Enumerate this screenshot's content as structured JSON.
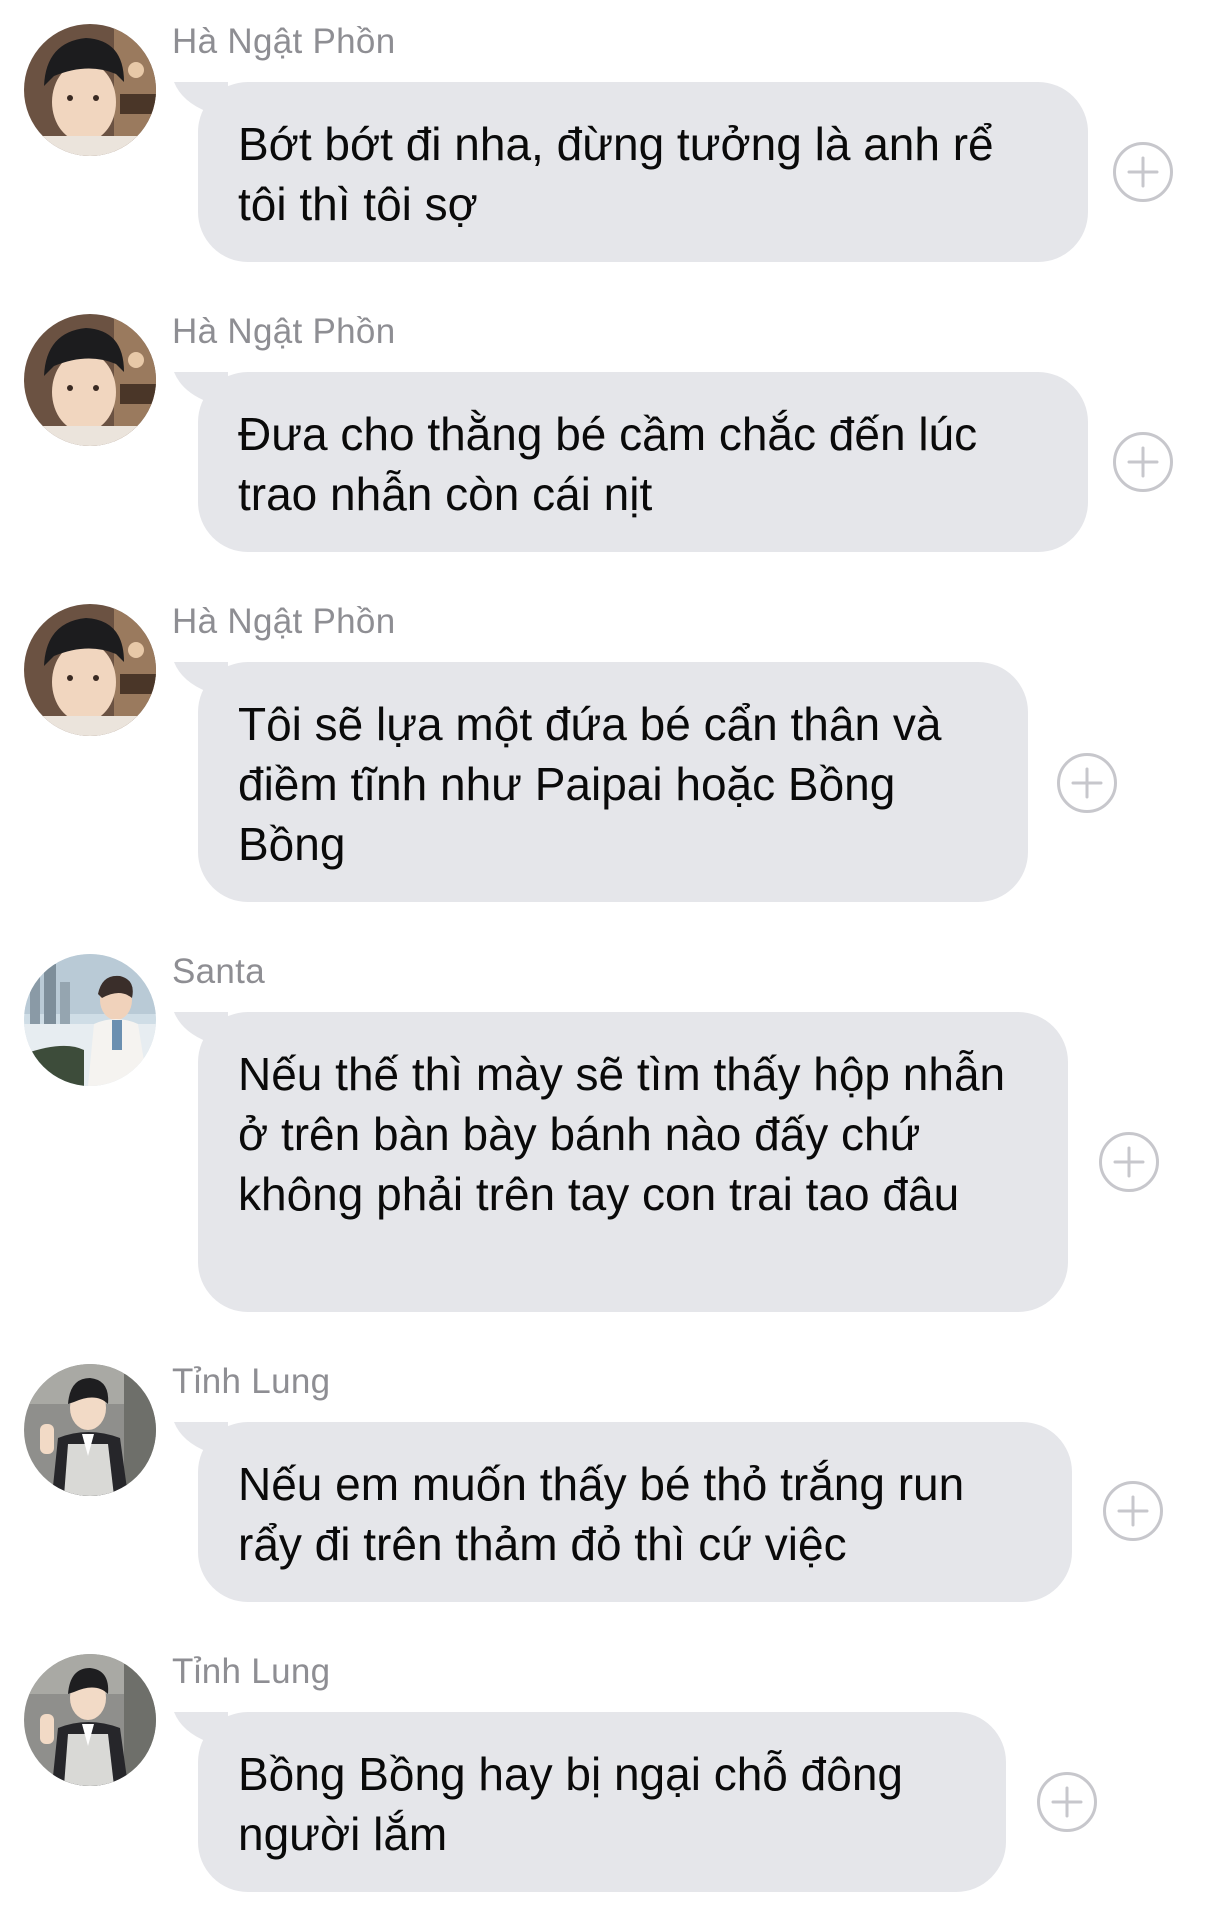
{
  "messages": [
    {
      "sender": "Hà Ngật Phồn",
      "avatar": "user-ha-ngat-phon",
      "text": "Bớt bớt đi nha, đừng tưởng là anh rể tôi thì tôi sợ"
    },
    {
      "sender": "Hà Ngật Phồn",
      "avatar": "user-ha-ngat-phon",
      "text": "Đưa cho thằng bé cầm chắc đến lúc trao nhẫn còn cái nịt"
    },
    {
      "sender": "Hà Ngật Phồn",
      "avatar": "user-ha-ngat-phon",
      "text": "Tôi sẽ lựa một đứa bé cẩn thân và điềm tĩnh như Paipai hoặc Bồng Bồng"
    },
    {
      "sender": "Santa",
      "avatar": "user-santa",
      "text": "Nếu thế thì mày sẽ tìm thấy hộp nhẫn ở trên bàn bày bánh nào đấy chứ không phải trên tay con trai tao đâu"
    },
    {
      "sender": "Tỉnh Lung",
      "avatar": "user-tinh-lung",
      "text": "Nếu em muốn thấy bé thỏ trắng run rẩy đi trên thảm đỏ thì cứ việc"
    },
    {
      "sender": "Tỉnh Lung",
      "avatar": "user-tinh-lung",
      "text": "Bồng Bồng hay bị ngại chỗ đông người lắm"
    }
  ],
  "icons": {
    "react": "add-reaction-icon"
  },
  "colors": {
    "bubble": "#e5e6ea",
    "sender_text": "#8e8e93",
    "message_text": "#0a0a0a",
    "plus_icon": "#c7c7cc"
  }
}
